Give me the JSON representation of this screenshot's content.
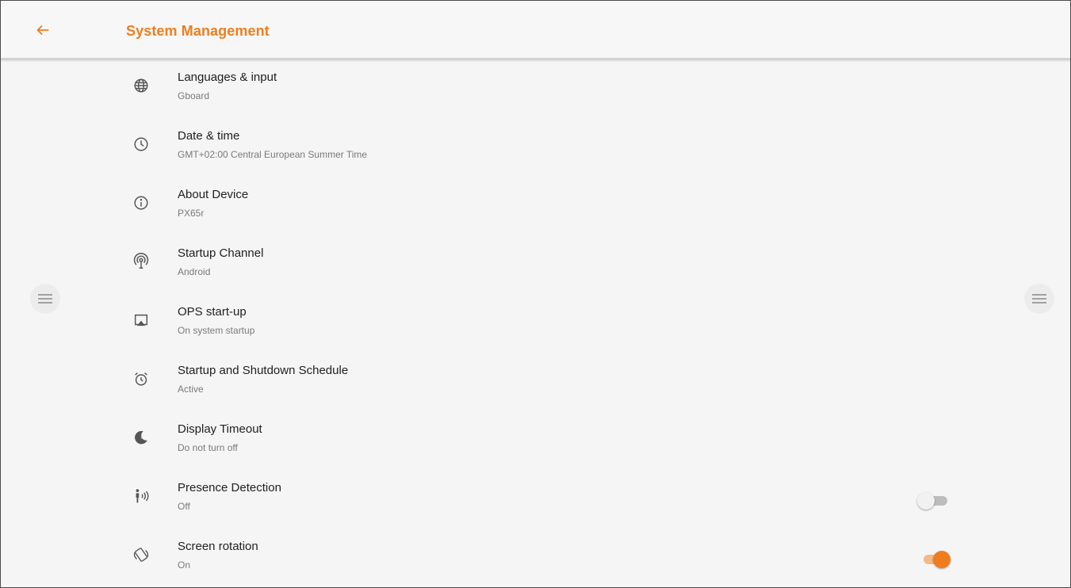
{
  "appbar": {
    "title": "System Management",
    "back_icon": "arrow-left-icon",
    "accent_color": "#ef7d1e"
  },
  "items": [
    {
      "icon": "globe-icon",
      "title": "Languages & input",
      "subtitle": "Gboard"
    },
    {
      "icon": "clock-icon",
      "title": "Date & time",
      "subtitle": "GMT+02:00 Central European Summer Time"
    },
    {
      "icon": "info-icon",
      "title": "About Device",
      "subtitle": "PX65r"
    },
    {
      "icon": "broadcast-antenna-icon",
      "title": "Startup Channel",
      "subtitle": "Android"
    },
    {
      "icon": "cast-screen-icon",
      "title": "OPS start-up",
      "subtitle": "On system startup"
    },
    {
      "icon": "alarm-clock-icon",
      "title": "Startup and Shutdown Schedule",
      "subtitle": "Active"
    },
    {
      "icon": "sleep-moon-icon",
      "title": "Display Timeout",
      "subtitle": "Do not turn off"
    },
    {
      "icon": "presence-sensor-icon",
      "title": "Presence Detection",
      "subtitle": "Off",
      "toggle": false
    },
    {
      "icon": "screen-rotation-icon",
      "title": "Screen rotation",
      "subtitle": "On",
      "toggle": true
    }
  ],
  "side_handles": {
    "left_icon": "hamburger-menu-icon",
    "right_icon": "hamburger-menu-icon"
  }
}
